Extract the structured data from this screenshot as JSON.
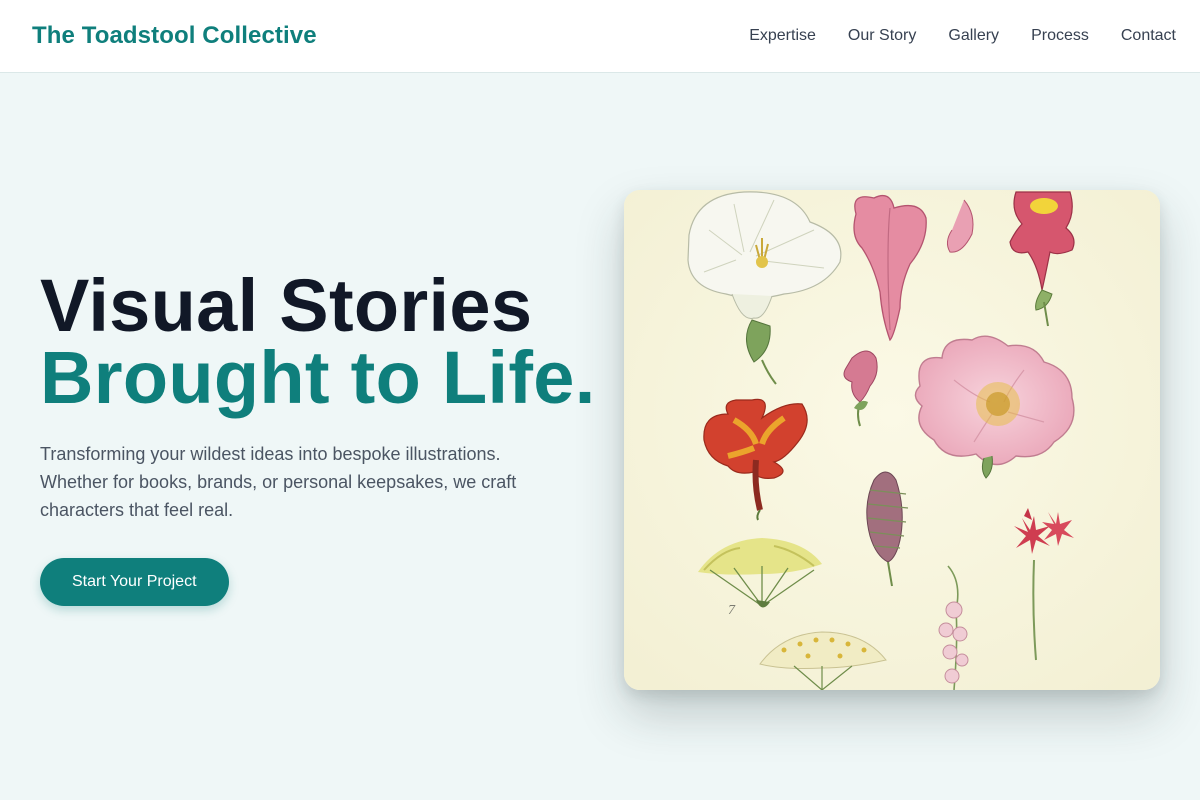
{
  "header": {
    "brand": "The Toadstool Collective",
    "nav": [
      "Expertise",
      "Our Story",
      "Gallery",
      "Process",
      "Contact"
    ]
  },
  "hero": {
    "headline_line1": "Visual Stories",
    "headline_line2": "Brought to Life.",
    "subtext": "Transforming your wildest ideas into bespoke illustrations. Whether for books, brands, or personal keepsakes, we craft characters that feel real.",
    "cta_label": "Start Your Project"
  },
  "illustration": {
    "plate_number": "7"
  },
  "colors": {
    "accent": "#0f7f7c",
    "heading": "#111827",
    "body_text": "#4b5563",
    "page_background": "#eff7f7",
    "plate_background": "#f8f6df"
  }
}
